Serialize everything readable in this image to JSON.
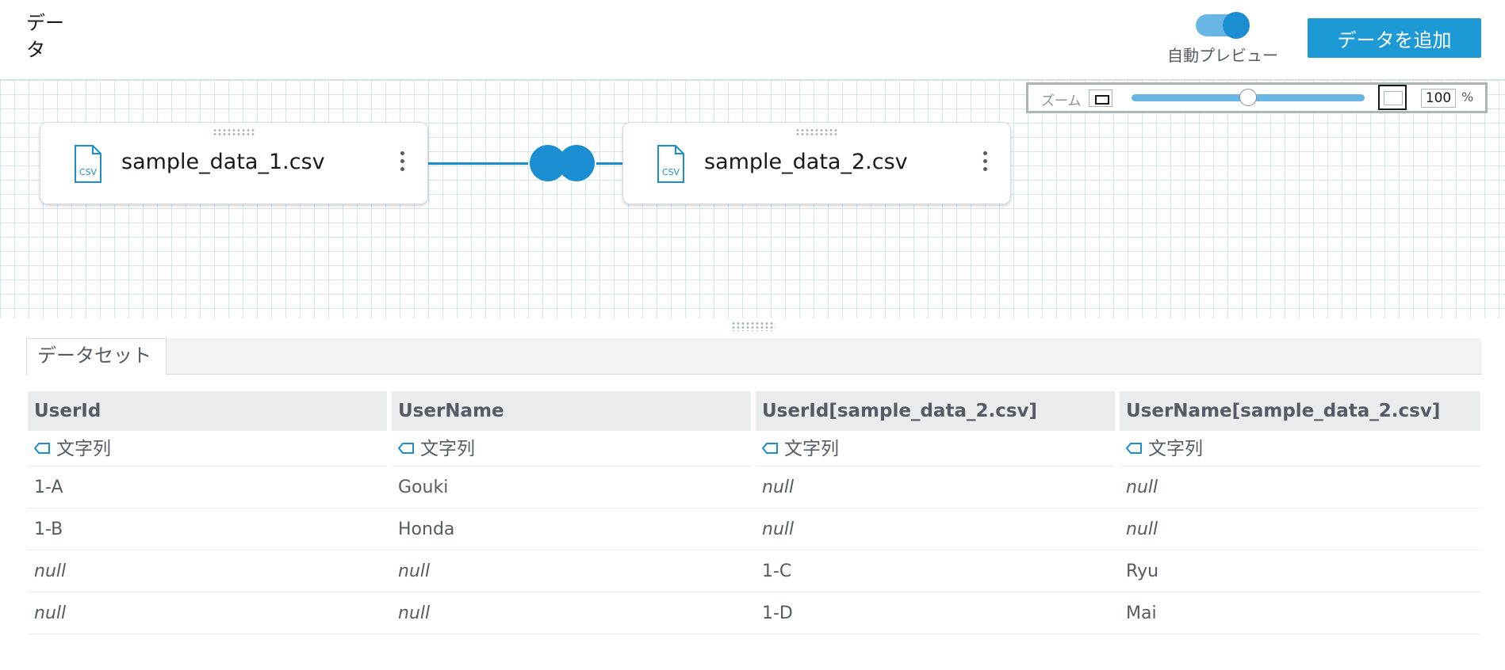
{
  "header": {
    "title": "データ",
    "auto_preview_label": "自動プレビュー",
    "auto_preview_on": true,
    "add_data_label": "データを追加"
  },
  "zoom": {
    "label": "ズーム",
    "value": "100",
    "unit": "%",
    "level_fraction": 0.5
  },
  "canvas": {
    "nodes": [
      {
        "name": "sample_data_1.csv",
        "icon": "csv-file-icon",
        "icon_text": "CSV"
      },
      {
        "name": "sample_data_2.csv",
        "icon": "csv-file-icon",
        "icon_text": "CSV"
      }
    ],
    "join_icon": "join-icon"
  },
  "panel": {
    "tab_label": "データセット"
  },
  "table": {
    "columns": [
      {
        "header": "UserId",
        "type": "文字列"
      },
      {
        "header": "UserName",
        "type": "文字列"
      },
      {
        "header": "UserId[sample_data_2.csv]",
        "type": "文字列"
      },
      {
        "header": "UserName[sample_data_2.csv]",
        "type": "文字列"
      }
    ],
    "rows": [
      [
        "1-A",
        "Gouki",
        "null",
        "null"
      ],
      [
        "1-B",
        "Honda",
        "null",
        "null"
      ],
      [
        "null",
        "null",
        "1-C",
        "Ryu"
      ],
      [
        "null",
        "null",
        "1-D",
        "Mai"
      ]
    ]
  },
  "colors": {
    "accent": "#1a8ed0",
    "button": "#1d9ad6",
    "grid_line": "#cfe6f3"
  }
}
